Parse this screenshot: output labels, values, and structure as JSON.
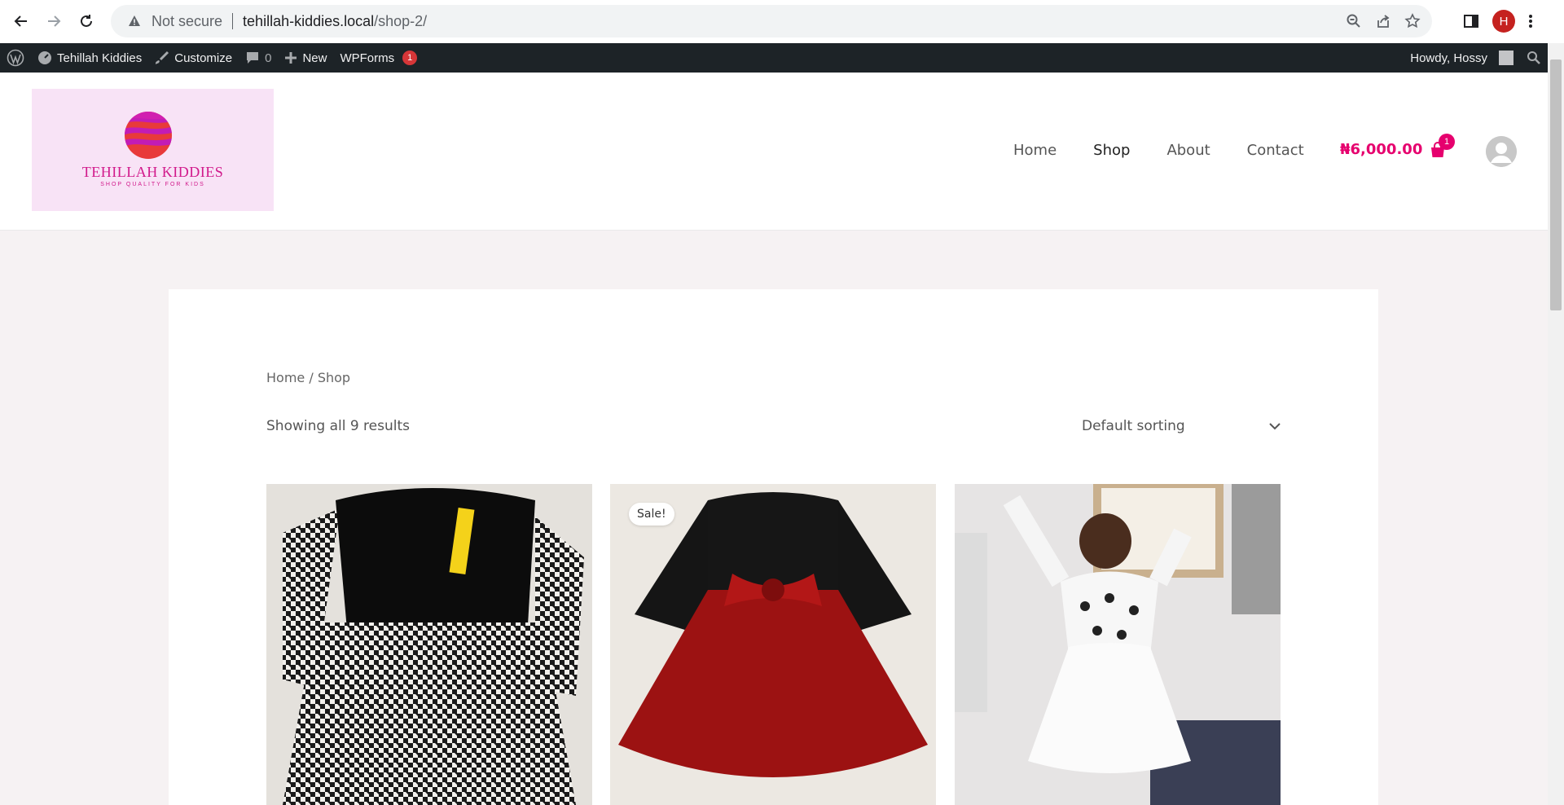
{
  "browser": {
    "security_label": "Not secure",
    "url_host": "tehillah-kiddies.local",
    "url_path": "/shop-2/",
    "profile_initial": "H"
  },
  "admin_bar": {
    "site_name": "Tehillah Kiddies",
    "customize": "Customize",
    "comments_count": "0",
    "new_label": "New",
    "wpforms_label": "WPForms",
    "wpforms_badge": "1",
    "howdy": "Howdy, Hossy"
  },
  "header": {
    "logo_name": "TEHILLAH KIDDIES",
    "logo_tagline": "SHOP QUALITY FOR KIDS",
    "nav": [
      {
        "label": "Home"
      },
      {
        "label": "Shop"
      },
      {
        "label": "About"
      },
      {
        "label": "Contact"
      }
    ],
    "cart_total": "₦6,000.00",
    "cart_count": "1"
  },
  "shop": {
    "breadcrumb": "Home / Shop",
    "result_count": "Showing all 9 results",
    "sorting_selected": "Default sorting",
    "products": [
      {
        "badge": ""
      },
      {
        "badge": "Sale!"
      },
      {
        "badge": ""
      }
    ]
  },
  "colors": {
    "accent": "#e6006e",
    "admin_bar": "#1d2327",
    "page_bg": "#f6f2f3",
    "logo_bg": "#f8e3f6"
  }
}
